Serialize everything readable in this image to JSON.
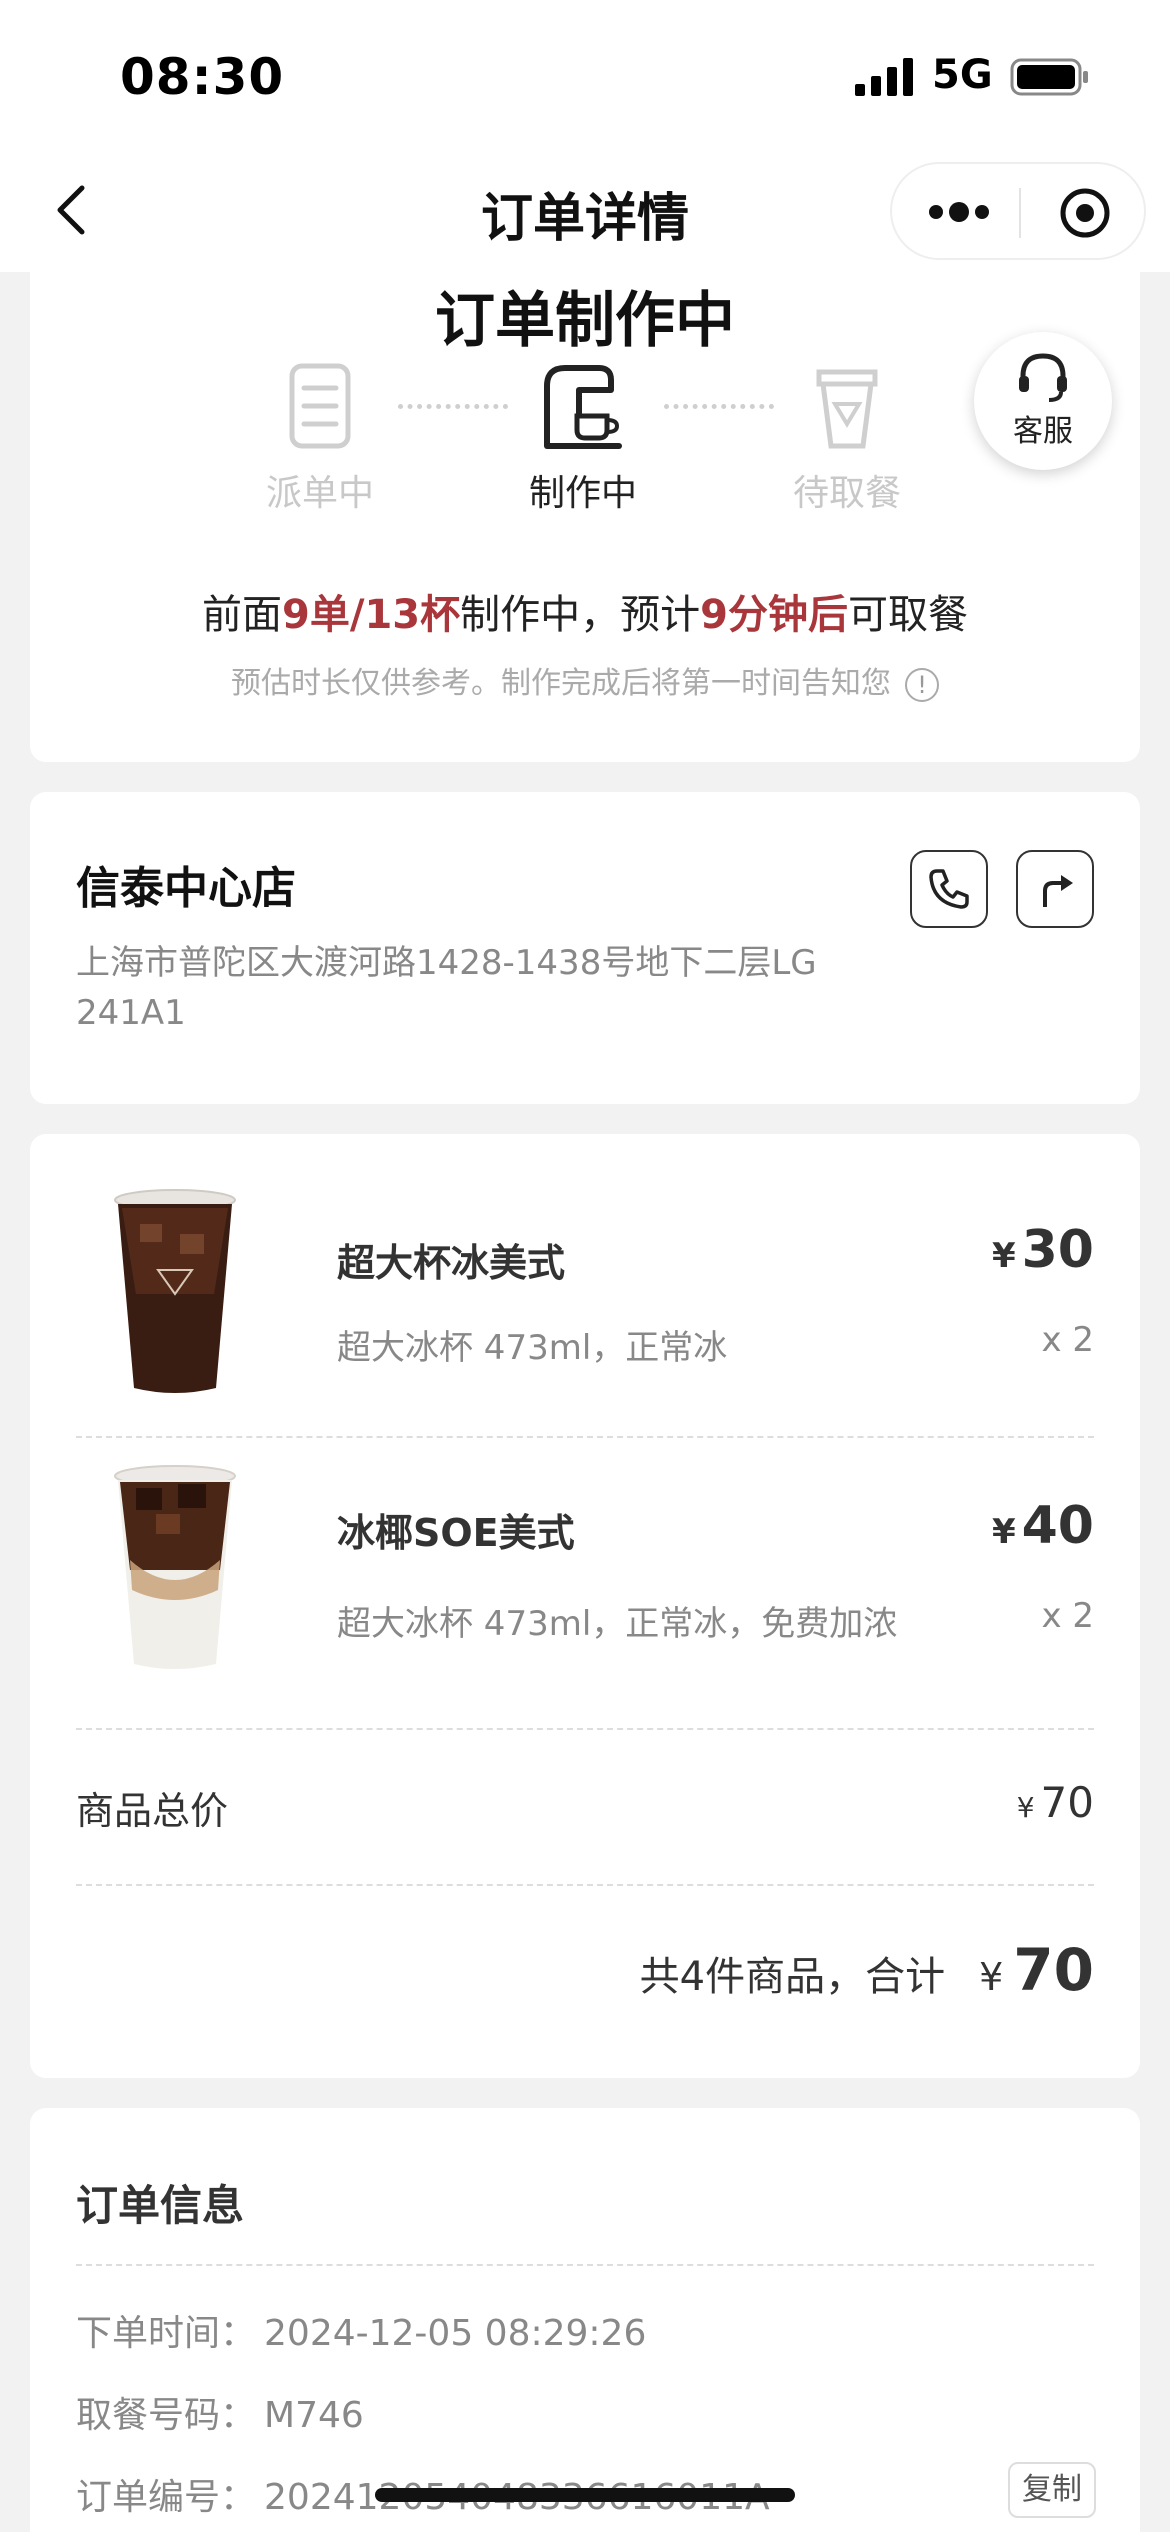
{
  "status_bar": {
    "time": "08:30",
    "network": "5G"
  },
  "nav": {
    "title": "订单详情"
  },
  "order_status": {
    "title": "订单制作中",
    "steps": [
      {
        "label": "派单中",
        "state": "done"
      },
      {
        "label": "制作中",
        "state": "active"
      },
      {
        "label": "待取餐",
        "state": "pending"
      }
    ],
    "service_label": "客服",
    "queue": {
      "prefix": "前面",
      "orders": "9单/13杯",
      "middle": "制作中，预计",
      "eta": "9分钟后",
      "suffix": "可取餐"
    },
    "hint": "预估时长仅供参考。制作完成后将第一时间告知您",
    "highlight_color": "#a8363a"
  },
  "store": {
    "name": "信泰中心店",
    "address": "上海市普陀区大渡河路1428-1438号地下二层LG 241A1"
  },
  "items": [
    {
      "name": "超大杯冰美式",
      "spec": "超大冰杯 473ml，正常冰",
      "currency": "¥",
      "price": "30",
      "qty": "x 2"
    },
    {
      "name": "冰椰SOE美式",
      "spec": "超大冰杯 473ml，正常冰，免费加浓",
      "currency": "¥",
      "price": "40",
      "qty": "x 2"
    }
  ],
  "subtotal": {
    "label": "商品总价",
    "currency": "¥",
    "value": "70"
  },
  "total": {
    "label": "共4件商品，合计",
    "currency": "¥",
    "value": "70"
  },
  "order_info": {
    "title": "订单信息",
    "rows": [
      {
        "label": "下单时间：",
        "value": "2024-12-05 08:29:26"
      },
      {
        "label": "取餐号码：",
        "value": "M746"
      },
      {
        "label": "订单编号：",
        "value": "202412054048336616011A"
      }
    ],
    "copy_label": "复制"
  }
}
